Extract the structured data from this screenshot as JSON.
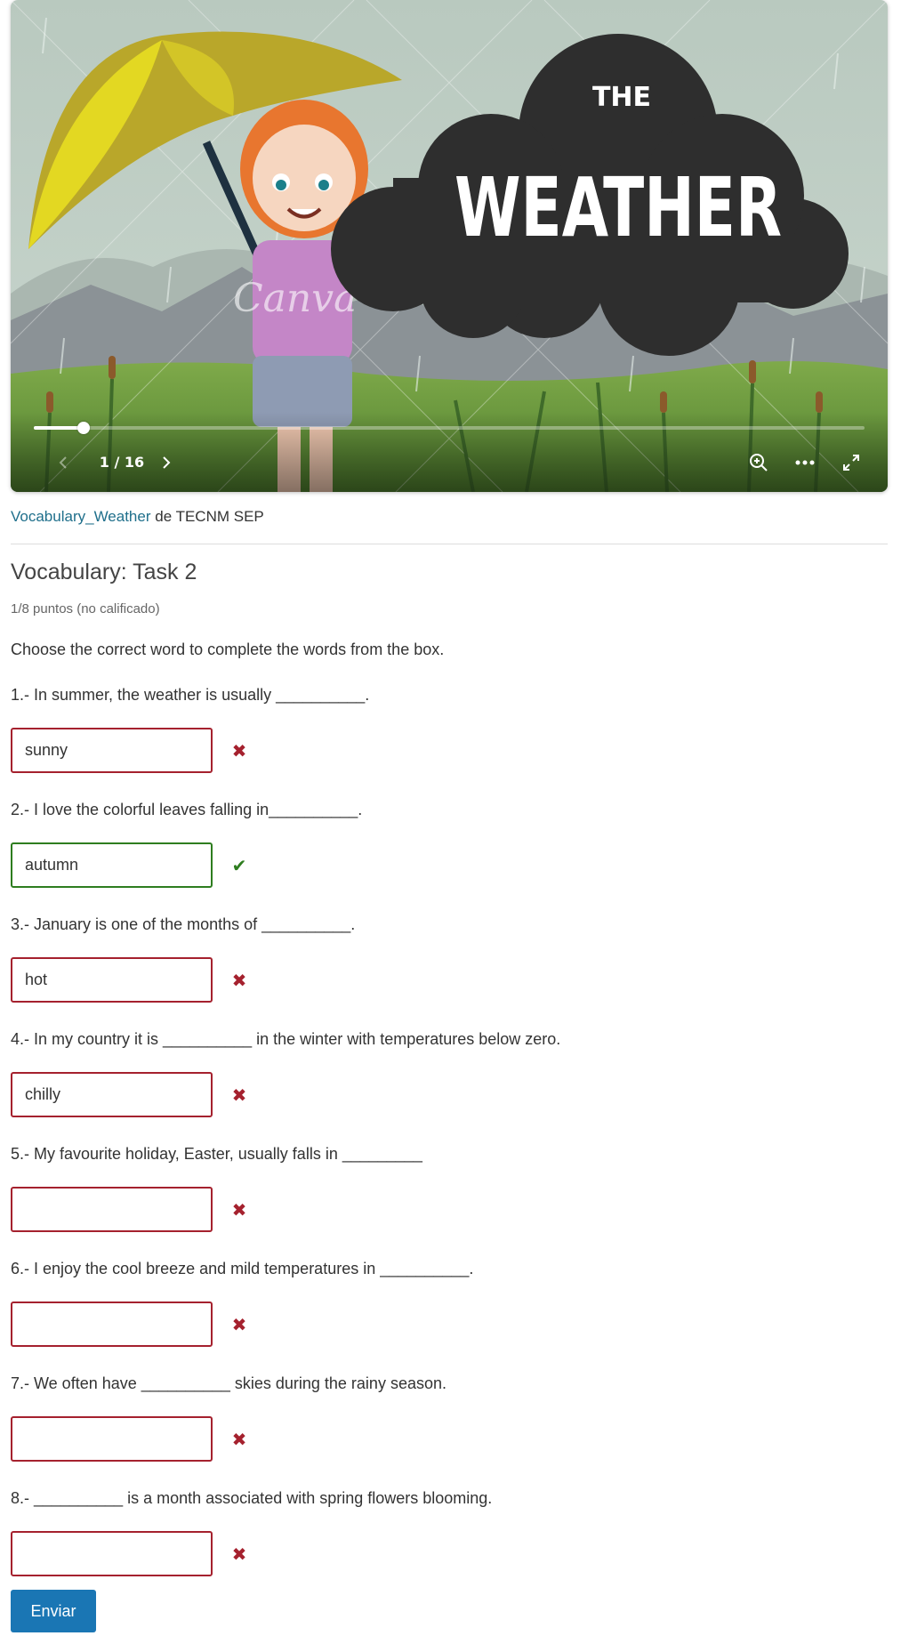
{
  "presentation": {
    "slide_title_small": "THE",
    "slide_title_large": "WEATHER",
    "watermark": "Canva",
    "counter": "1 / 16",
    "current_slide": 1,
    "total_slides": 16,
    "icons": {
      "prev": "chevron-left-icon",
      "next": "chevron-right-icon",
      "zoom": "zoom-in-icon",
      "more": "more-horizontal-icon",
      "fullscreen": "fullscreen-icon"
    }
  },
  "attribution": {
    "link_text": "Vocabulary_Weather",
    "suffix": " de TECNM SEP"
  },
  "quiz": {
    "title": "Vocabulary: Task 2",
    "score": "1/8 puntos (no calificado)",
    "instructions": "Choose the correct word to complete the words from the box.",
    "questions": [
      {
        "text": "1.- In summer, the weather is usually __________.",
        "answer": "sunny",
        "status": "incorrect"
      },
      {
        "text": "2.- I love the colorful leaves falling in__________.",
        "answer": "autumn",
        "status": "correct"
      },
      {
        "text": "3.- January is one of the months of __________.",
        "answer": "hot",
        "status": "incorrect"
      },
      {
        "text": "4.- In my country it is __________ in the winter with temperatures below zero.",
        "answer": "chilly",
        "status": "incorrect"
      },
      {
        "text": "5.- My favourite holiday, Easter, usually falls in _________",
        "answer": "",
        "status": "incorrect"
      },
      {
        "text": "6.- I enjoy the cool breeze and mild temperatures in __________.",
        "answer": "",
        "status": "incorrect"
      },
      {
        "text": "7.- We often have __________ skies during the rainy season.",
        "answer": "",
        "status": "incorrect"
      },
      {
        "text": "8.- __________ is a month associated with spring flowers blooming.",
        "answer": "",
        "status": "incorrect"
      }
    ],
    "submit_label": "Enviar"
  },
  "colors": {
    "link": "#1f6f8b",
    "incorrect": "#a5212e",
    "correct": "#2e7d1f",
    "submit": "#1a76b4",
    "cloud": "#2e2e2e"
  }
}
